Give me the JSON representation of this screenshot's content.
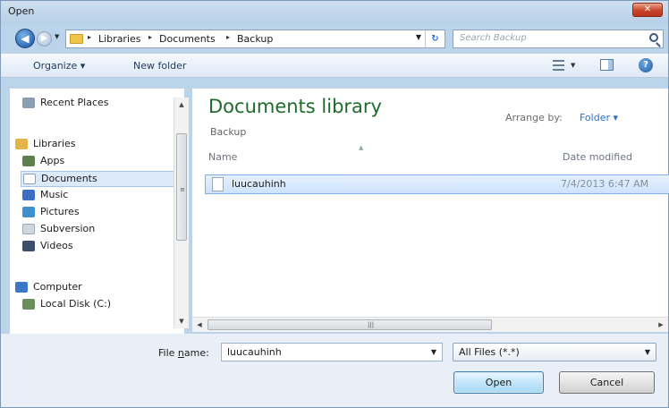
{
  "window": {
    "title": "Open",
    "close_glyph": "✕"
  },
  "address": {
    "back_glyph": "◀",
    "forward_glyph": "▶",
    "history_glyph": "▼",
    "breadcrumbs": [
      "Libraries",
      "Documents",
      "Backup"
    ],
    "separator": "▸",
    "dropdown_glyph": "▼",
    "refresh_glyph": "↻"
  },
  "search": {
    "placeholder": "Search Backup",
    "icon": "search-icon"
  },
  "toolbar": {
    "organize_label": "Organize ▾",
    "new_folder_label": "New folder",
    "view_dropdown_glyph": "▼",
    "help_glyph": "?"
  },
  "sidebar": {
    "items": [
      {
        "label": "Recent Places",
        "icon": "recent-places-icon",
        "color": "#8a9eb4"
      },
      {
        "label": "Libraries",
        "icon": "libraries-icon",
        "color": "#e6b54a"
      },
      {
        "label": "Apps",
        "icon": "apps-icon",
        "color": "#5f7f4f"
      },
      {
        "label": "Documents",
        "icon": "documents-icon",
        "color": "#ffffff"
      },
      {
        "label": "Music",
        "icon": "music-icon",
        "color": "#3a6fc4"
      },
      {
        "label": "Pictures",
        "icon": "pictures-icon",
        "color": "#3f8fcf"
      },
      {
        "label": "Subversion",
        "icon": "subversion-icon",
        "color": "#cfd8e2"
      },
      {
        "label": "Videos",
        "icon": "videos-icon",
        "color": "#3b4f6b"
      },
      {
        "label": "Computer",
        "icon": "computer-icon",
        "color": "#3c78c8"
      },
      {
        "label": "Local Disk (C:)",
        "icon": "local-disk-icon",
        "color": "#6a8f5a"
      }
    ],
    "scroll_up_glyph": "▲",
    "scroll_down_glyph": "▼",
    "grip_glyph": "≡"
  },
  "main": {
    "library_title": "Documents library",
    "library_subtitle": "Backup",
    "arrange_by_label": "Arrange by:",
    "arrange_by_value": "Folder ▾",
    "sort_caret": "▲",
    "columns": {
      "name": "Name",
      "date_modified": "Date modified"
    },
    "files": [
      {
        "name": "luucauhinh",
        "date_modified": "7/4/2013 6:47 AM"
      }
    ],
    "hscroll_left_glyph": "◀",
    "hscroll_right_glyph": "▶",
    "hscroll_grip_glyph": "|||"
  },
  "footer": {
    "file_name_label_pre": "File ",
    "file_name_label_u": "n",
    "file_name_label_post": "ame:",
    "file_name_value": "luucauhinh",
    "file_type_value": "All Files (*.*)",
    "dropdown_glyph": "▼",
    "open_label": "Open",
    "cancel_label": "Cancel"
  }
}
